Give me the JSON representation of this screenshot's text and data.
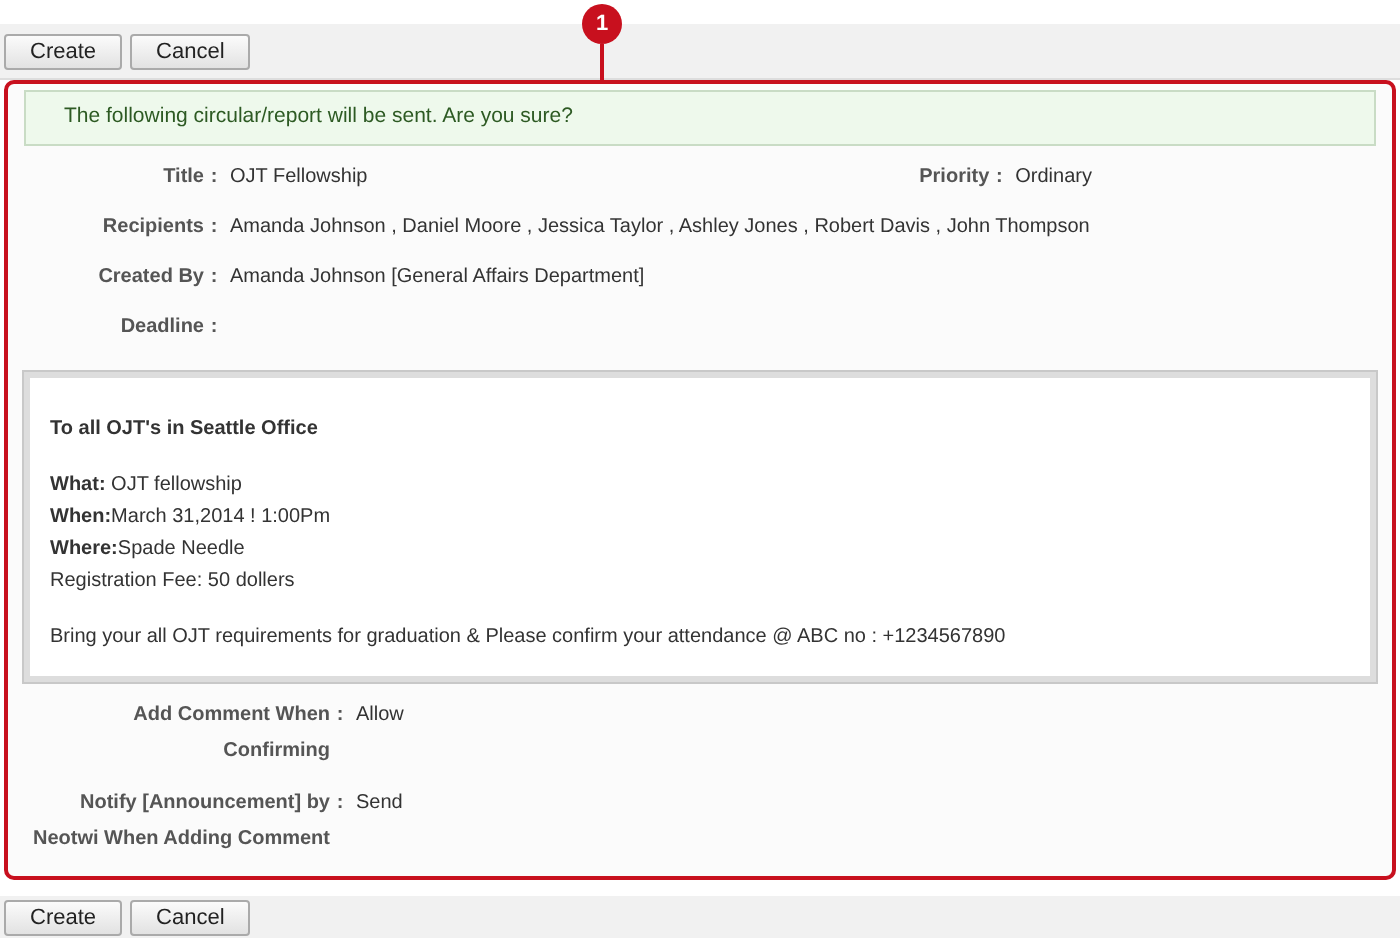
{
  "top_buttons": [
    "Create",
    "Cancel"
  ],
  "callout": "1",
  "notice": "The following circular/report will be sent. Are you sure?",
  "fields": [
    {
      "label": "Title",
      "colon": ":",
      "value": "OJT Fellowship",
      "side": {
        "label": "Priority",
        "colon": ":",
        "value": "Ordinary"
      }
    },
    {
      "label": "Recipients",
      "colon": ":",
      "value": "Amanda Johnson , Daniel Moore , Jessica Taylor , Ashley Jones , Robert Davis , John Thompson"
    },
    {
      "label": "Created By",
      "colon": ":",
      "value": "Amanda Johnson [General Affairs Department]"
    },
    {
      "label": "Deadline",
      "colon": ":"
    }
  ],
  "message": {
    "heading": "To all OJT's in Seattle Office",
    "lines": [
      "**What:** OJT fellowship",
      "**When:**March 31,2014 ! 1:00Pm",
      "**Where:**Spade Needle",
      "Registration Fee: 50 dollers"
    ],
    "closing": "Bring your all OJT requirements for graduation & Please confirm your attendance @ ABC no : +1234567890"
  },
  "options": [
    {
      "label_lines": [
        "Add Comment When",
        "Confirming"
      ],
      "colon": ":",
      "value": "Allow"
    },
    {
      "label_lines": [
        "Notify [Announcement] by",
        "Neotwi When Adding Comment"
      ],
      "colon": ":",
      "value": "Send"
    }
  ],
  "bottom_buttons": [
    "Create",
    "Cancel"
  ]
}
